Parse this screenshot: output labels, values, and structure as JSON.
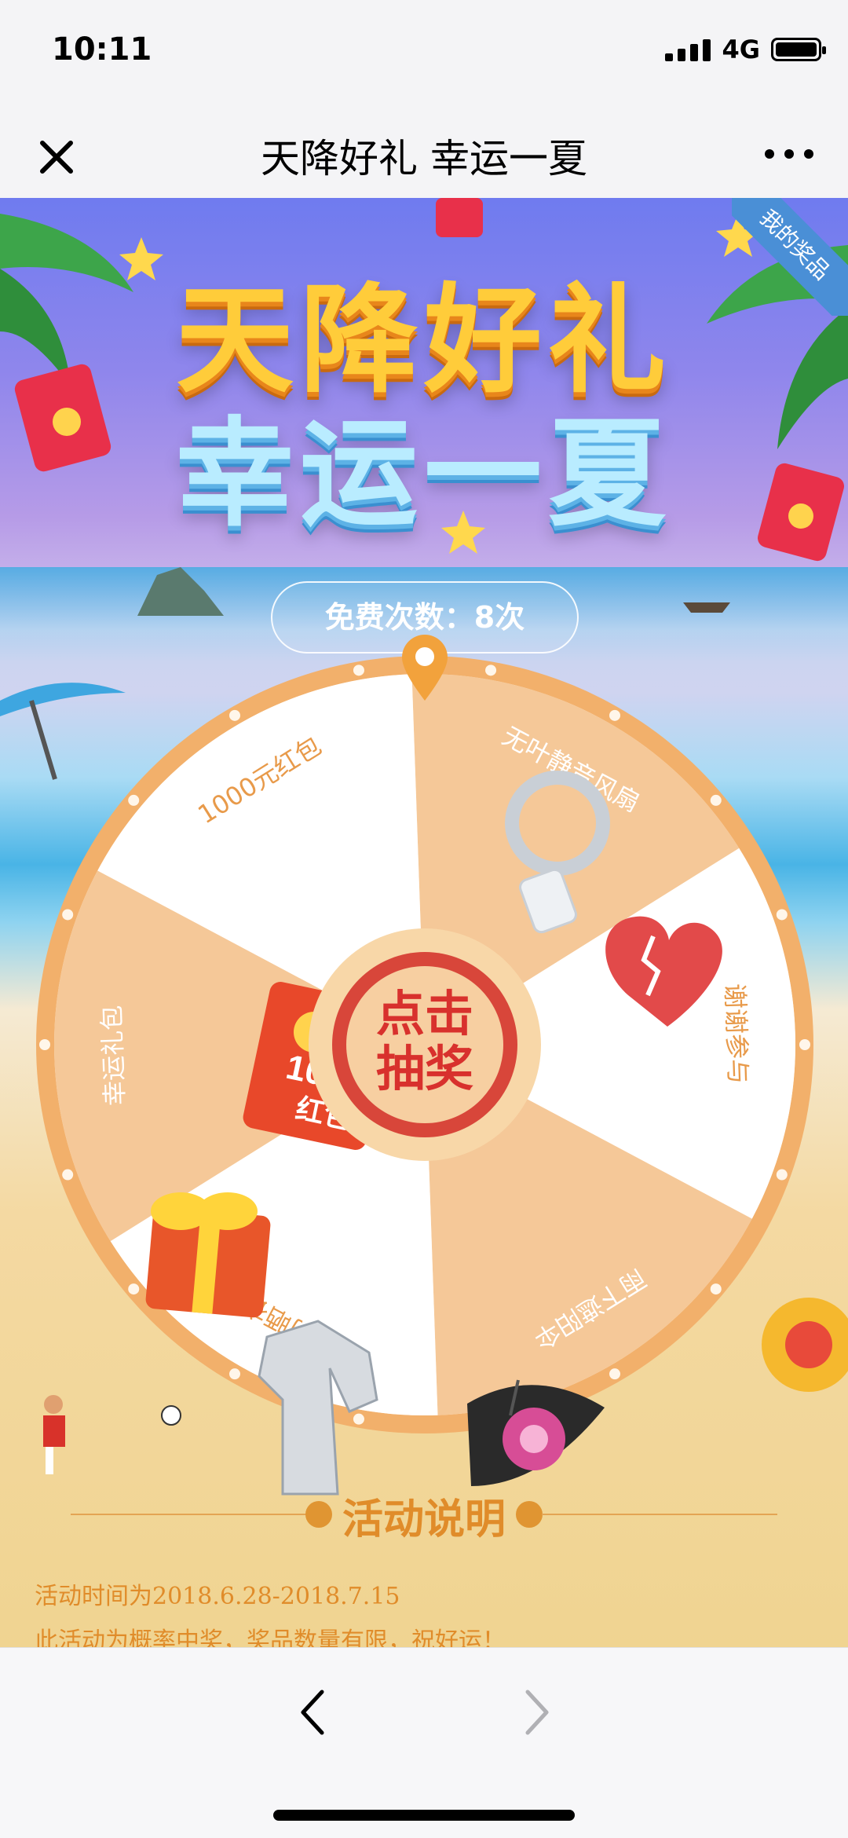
{
  "status": {
    "time": "10:11",
    "network": "4G"
  },
  "nav": {
    "title": "天降好礼 幸运一夏"
  },
  "banner": {
    "line1": "天降好礼",
    "line2": "幸运一夏",
    "my_prizes": "我的奖品"
  },
  "free": {
    "label": "免费次数：8次"
  },
  "wheel": {
    "prizes": [
      "无叶静音风扇",
      "谢谢参与",
      "雨下遮阳伞",
      "防晒衣",
      "幸运礼包",
      "1000元红包"
    ],
    "redpack_amount": "1000",
    "redpack_word": "红包",
    "button": {
      "line1": "点击",
      "line2": "抽奖"
    }
  },
  "activity": {
    "title": "活动说明",
    "lines": [
      "活动时间为2018.6.28-2018.7.15",
      "此活动为概率中奖，奖品数量有限，祝好运！"
    ]
  },
  "colors": {
    "wheel_rim": "#f2b06b",
    "seg_orange": "#f5c898",
    "seg_white": "#ffffff",
    "accent": "#e08c2a"
  }
}
